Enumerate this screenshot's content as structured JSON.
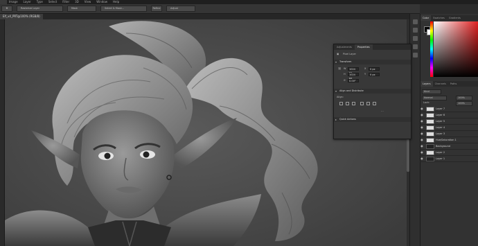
{
  "menubar": {
    "items": [
      "Image",
      "Layer",
      "Type",
      "Select",
      "Filter",
      "3D",
      "View",
      "Window",
      "Help"
    ]
  },
  "options_bar": {
    "buttons": [
      "Rasterize Layer",
      "Mask",
      "Select & Mask...",
      "Refine",
      "Adjust"
    ]
  },
  "document": {
    "tab_title": "Elf_v4_PRT@100% (RGB/8)"
  },
  "properties_panel": {
    "tabs": [
      "Adjustments",
      "Properties"
    ],
    "active_tab": "Properties",
    "layer_type": "Pixel Layer",
    "sections": [
      "Transform",
      "Align and Distribute",
      "Quick Actions"
    ],
    "transform": {
      "w": "1024 px",
      "h": "1024 px",
      "x": "0 px",
      "y": "0 px",
      "angle": "0.00°"
    },
    "align_label": "Align:",
    "more_label": "...",
    "quick_actions_label": "Quick Actions"
  },
  "color_panel": {
    "tabs": [
      "Color",
      "Swatches",
      "Gradients"
    ],
    "active_tab": "Color",
    "foreground": "#000000",
    "background": "#ffffff"
  },
  "layers_panel": {
    "tabs": [
      "Layers",
      "Channels",
      "Paths"
    ],
    "active_tab": "Layers",
    "kind_label": "Kind",
    "blend_mode": "Normal",
    "opacity": "100%",
    "lock_label": "Lock:",
    "fill": "100%",
    "layers": [
      {
        "name": "Layer 7",
        "thumb": "white",
        "visible": true
      },
      {
        "name": "Layer 6",
        "thumb": "white",
        "visible": true
      },
      {
        "name": "Layer 5",
        "thumb": "white",
        "visible": true
      },
      {
        "name": "Layer 4",
        "thumb": "white",
        "visible": true
      },
      {
        "name": "Layer 3",
        "thumb": "white",
        "visible": true
      },
      {
        "name": "Hue/Saturation 1",
        "thumb": "white",
        "visible": true
      },
      {
        "name": "Background",
        "thumb": "dark",
        "visible": true
      },
      {
        "name": "Layer 2",
        "thumb": "white",
        "visible": true
      },
      {
        "name": "Layer 1",
        "thumb": "dark",
        "visible": true
      }
    ]
  }
}
